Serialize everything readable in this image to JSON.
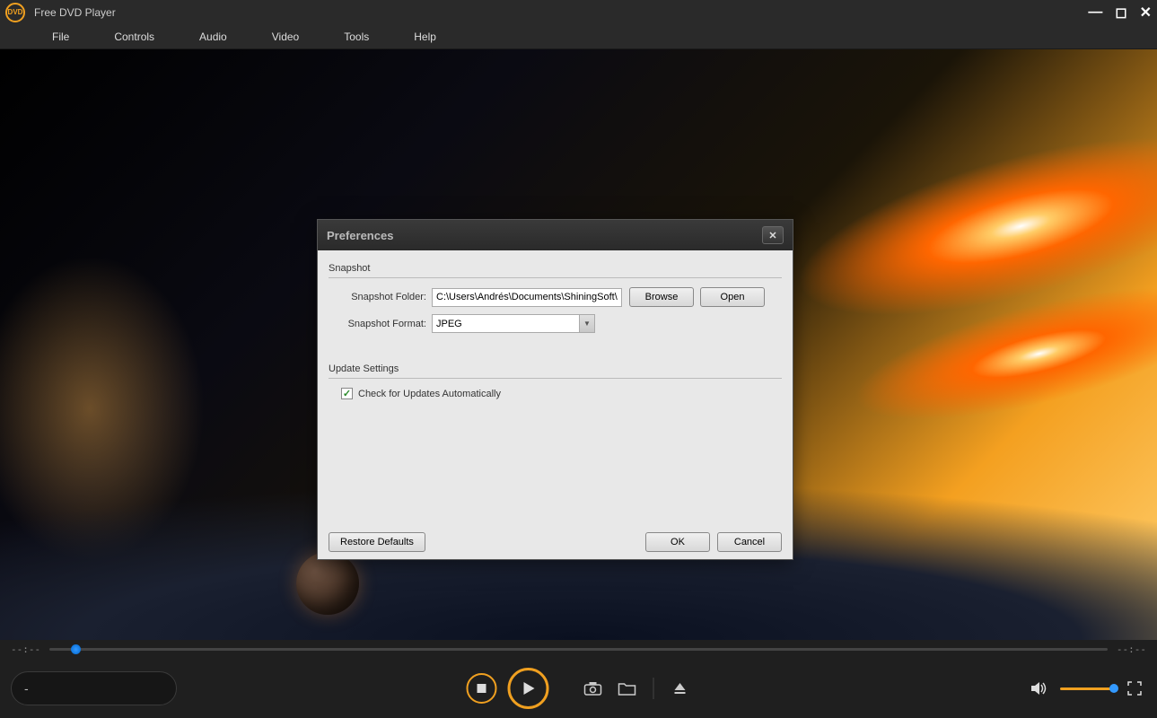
{
  "app": {
    "title": "Free DVD Player",
    "logo_text": "DVD"
  },
  "menu": {
    "file": "File",
    "controls": "Controls",
    "audio": "Audio",
    "video": "Video",
    "tools": "Tools",
    "help": "Help"
  },
  "seek": {
    "current": "--:--",
    "total": "--:--"
  },
  "player": {
    "time_display": "-"
  },
  "dialog": {
    "title": "Preferences",
    "snapshot": {
      "section": "Snapshot",
      "folder_label": "Snapshot Folder:",
      "folder_value": "C:\\Users\\Andrés\\Documents\\ShiningSoft\\Sn",
      "browse": "Browse",
      "open": "Open",
      "format_label": "Snapshot Format:",
      "format_value": "JPEG"
    },
    "update": {
      "section": "Update Settings",
      "check_label": "Check for Updates Automatically",
      "checked": true
    },
    "buttons": {
      "restore": "Restore Defaults",
      "ok": "OK",
      "cancel": "Cancel"
    }
  }
}
